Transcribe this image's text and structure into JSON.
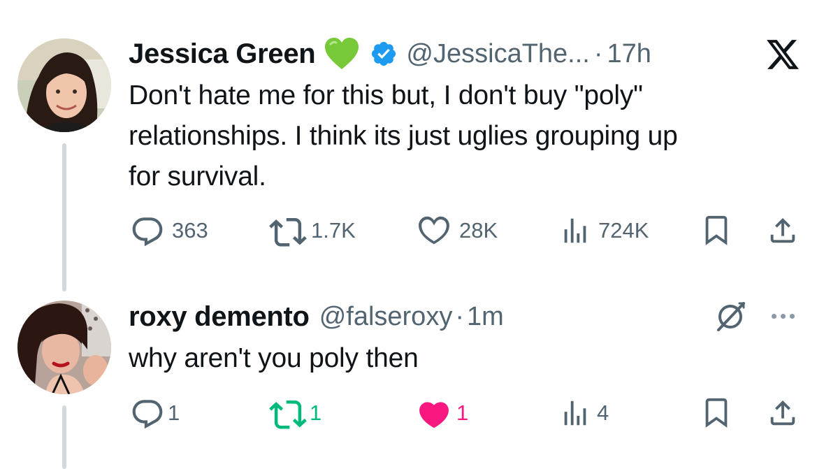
{
  "colors": {
    "text": "#0f1419",
    "secondary": "#536471",
    "verified": "#1d9bf0",
    "heart_emoji": "#77c93a",
    "retweet_active": "#00ba7c",
    "like_active": "#f91880"
  },
  "tweet": {
    "author_name": "Jessica Green",
    "name_emoji": "green-heart",
    "verified": true,
    "handle": "@JessicaThe...",
    "separator": "·",
    "time": "17h",
    "text_lines": [
      "Don't hate me for this but, I don't buy \"poly\"",
      "relationships. I think its just uglies grouping up",
      "for survival."
    ],
    "actions": {
      "replies": "363",
      "retweets": "1.7K",
      "likes": "28K",
      "views": "724K"
    },
    "icons": {
      "reply": "reply-icon",
      "retweet": "retweet-icon",
      "like": "heart-icon",
      "views": "views-icon",
      "bookmark": "bookmark-icon",
      "share": "share-icon",
      "brand": "x-logo-icon"
    }
  },
  "reply": {
    "author_name": "roxy demento",
    "handle": "@falseroxy",
    "separator": "·",
    "time": "1m",
    "text": "why aren't you poly then",
    "actions": {
      "replies": "1",
      "retweets": "1",
      "likes": "1",
      "views": "4"
    },
    "retweeted": true,
    "liked": true,
    "icons": {
      "grok": "grok-icon",
      "more": "more-icon"
    }
  }
}
